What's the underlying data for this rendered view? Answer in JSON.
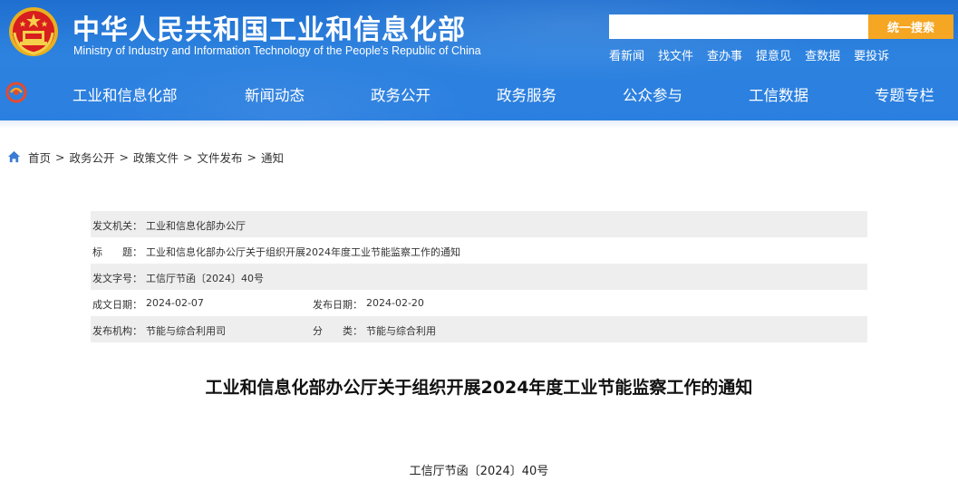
{
  "header": {
    "title_cn": "中华人民共和国工业和信息化部",
    "title_en": "Ministry of Industry and Information Technology of the People's Republic of China",
    "emblem_icon": "national-emblem-icon",
    "search": {
      "placeholder": "",
      "button_label": "统一搜索"
    },
    "quick_links": [
      "看新闻",
      "找文件",
      "查办事",
      "提意见",
      "查数据",
      "要投诉"
    ],
    "nav_items": [
      "工业和信息化部",
      "新闻动态",
      "政务公开",
      "政务服务",
      "公众参与",
      "工信数据",
      "专题专栏"
    ],
    "colors": {
      "header_blue": "#2b7fe0",
      "search_button": "#f5a623"
    }
  },
  "breadcrumb": {
    "home_icon": "home-icon",
    "items": [
      "首页",
      "政务公开",
      "政策文件",
      "文件发布",
      "通知"
    ],
    "separator": ">"
  },
  "meta": {
    "issuer_label": "发文机关：",
    "issuer": "工业和信息化部办公厅",
    "title_label": "标　　题：",
    "title": "工业和信息化部办公厅关于组织开展2024年度工业节能监察工作的通知",
    "doc_no_label": "发文字号：",
    "doc_no": "工信厅节函〔2024〕40号",
    "written_date_label": "成文日期：",
    "written_date": "2024-02-07",
    "publish_date_label": "发布日期：",
    "publish_date": "2024-02-20",
    "org_label": "发布机构：",
    "org": "节能与综合利用司",
    "category_label": "分　　类：",
    "category": "节能与综合利用"
  },
  "article": {
    "title": "工业和信息化部办公厅关于组织开展2024年度工业节能监察工作的通知",
    "doc_number": "工信厅节函〔2024〕40号"
  }
}
